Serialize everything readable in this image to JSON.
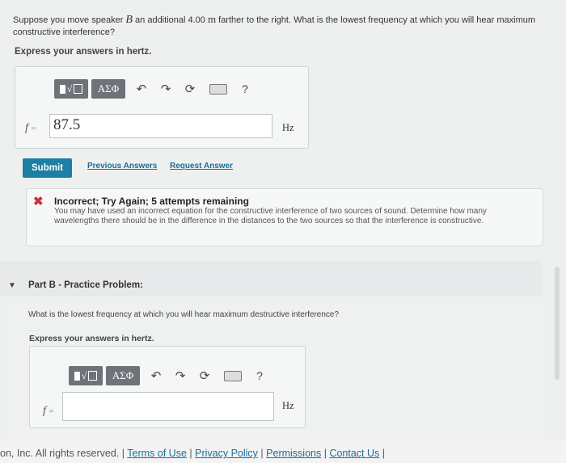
{
  "partA": {
    "question_pre": "Suppose you move speaker ",
    "question_var": "B",
    "question_mid": " an additional 4.00 ",
    "question_unit": "m",
    "question_post": " farther to the right. What is the lowest frequency at which you will hear maximum constructive interference?",
    "express": "Express your answers in hertz.",
    "toolbar": {
      "greek": "ΑΣΦ",
      "help": "?"
    },
    "var_label": "f",
    "eq": "=",
    "answer_value": "87.5",
    "unit": "Hz"
  },
  "actions": {
    "submit": "Submit",
    "previous_answers": "Previous Answers",
    "request_answer": "Request Answer"
  },
  "feedback": {
    "icon": "x-icon",
    "title": "Incorrect; Try Again; 5 attempts remaining",
    "text": "You may have used an incorrect equation for the constructive interference of two sources of sound. Determine how many wavelengths there should be in the difference in the distances to the two sources so that the interference is constructive."
  },
  "partB": {
    "title": "Part B - Practice Problem:",
    "question": "What is the lowest frequency at which you will hear maximum destructive interference?",
    "express": "Express your answers in hertz.",
    "toolbar": {
      "greek": "ΑΣΦ",
      "help": "?"
    },
    "var_label": "f",
    "eq": "=",
    "answer_value": "",
    "unit": "Hz"
  },
  "footer": {
    "copyright": "on, Inc. All rights reserved.",
    "sep": "|",
    "terms": "Terms of Use",
    "privacy": "Privacy Policy",
    "permissions": "Permissions",
    "contact": "Contact Us"
  },
  "colors": {
    "submit": "#1c7fa3",
    "link": "#1b6e99",
    "error": "#cc3333",
    "toolbar_btn": "#6d7378"
  }
}
